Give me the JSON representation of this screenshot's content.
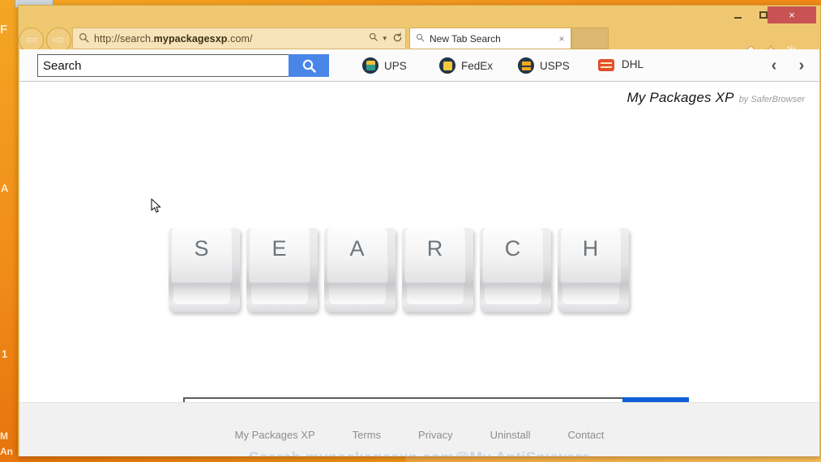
{
  "desktop": {
    "background_color": "#ef8f16",
    "partial_letters": [
      "F",
      "A",
      "1",
      "M",
      "An"
    ]
  },
  "window": {
    "chrome_color": "#eec067",
    "controls": {
      "minimize_label": "Minimize",
      "maximize_label": "Maximize",
      "close_label": "×",
      "close_color": "#c75353"
    },
    "nav": {
      "back_label": "⇦",
      "forward_label": "⇨"
    },
    "address": {
      "search_icon": "search-icon",
      "url_prefix": "http://search.",
      "url_domain": "mypackagesxp",
      "url_suffix": ".com/",
      "full_url": "http://search.mypackagesxp.com/",
      "zoom_icon": "zoom-search-icon",
      "refresh_icon": "refresh-icon"
    },
    "tabs": [
      {
        "label": "New Tab Search",
        "icon": "search-icon",
        "close_label": "×",
        "active": true
      }
    ],
    "new_tab_label": "",
    "actions": [
      {
        "name": "home-icon",
        "glyph": "⌂"
      },
      {
        "name": "favorites-icon",
        "glyph": "★"
      },
      {
        "name": "settings-gear-icon",
        "glyph": "⚙"
      }
    ]
  },
  "extension_toolbar": {
    "search_value": "Search",
    "search_placeholder": "Search",
    "search_button_icon": "search-icon",
    "carriers": [
      {
        "label": "UPS",
        "icon": "ups-package-icon",
        "icon_style": "dark",
        "box_color": "#f3c13a",
        "accent": "#2e9b8f"
      },
      {
        "label": "FedEx",
        "icon": "fedex-package-icon",
        "icon_style": "dark",
        "box_color": "#f5c93c",
        "accent": "#f0bc2c"
      },
      {
        "label": "USPS",
        "icon": "usps-envelope-icon",
        "icon_style": "dark",
        "box_color": "#f2a81f",
        "accent": "#e8930f"
      },
      {
        "label": "DHL",
        "icon": "dhl-truck-icon",
        "icon_style": "solid",
        "box_color": "#e2502a",
        "accent": "#e2502a"
      }
    ],
    "prev_label": "‹",
    "next_label": "›"
  },
  "page": {
    "brand_name": "My Packages XP",
    "brand_by": "by SaferBrowser",
    "hero_keys": [
      "S",
      "E",
      "A",
      "R",
      "C",
      "H"
    ],
    "search": {
      "value": "",
      "placeholder": "",
      "button_icon": "search-icon"
    },
    "footer": {
      "links": [
        "My Packages XP",
        "Terms",
        "Privacy",
        "Uninstall",
        "Contact"
      ],
      "watermark": "Search.mypackagesxp.com@My AntiSpyware"
    }
  },
  "colors": {
    "chrome": "#eec067",
    "accent_blue": "#0e5fd8",
    "toolbar_blue": "#4a86e8",
    "close_red": "#c75353",
    "desktop_orange": "#ef8f16"
  }
}
